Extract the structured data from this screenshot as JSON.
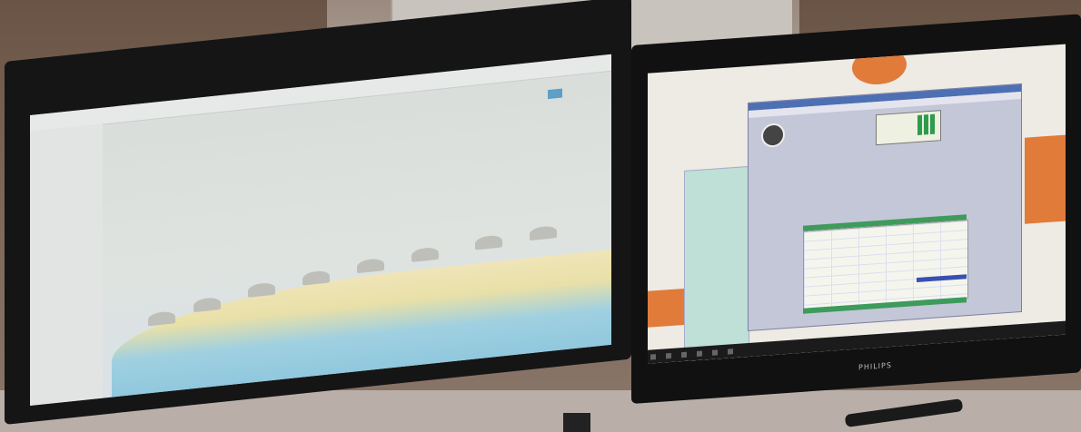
{
  "scene": {
    "description_visible_text": {
      "monitor_brand": "PHILIPS"
    }
  }
}
